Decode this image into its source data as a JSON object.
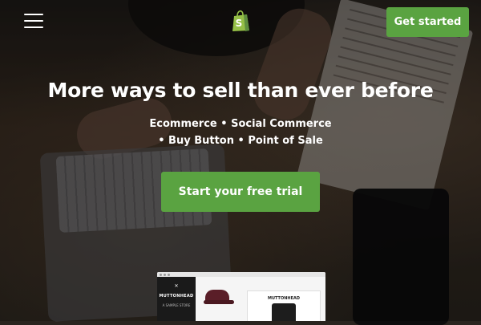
{
  "header": {
    "menu_icon": "hamburger-menu-icon",
    "logo_icon": "shopify-bag-icon",
    "cta_label": "Get started"
  },
  "hero": {
    "headline": "More ways to sell than ever before",
    "subline_1": "Ecommerce • Social Commerce",
    "subline_2": "• Buy Button • Point of Sale",
    "cta_label": "Start your free trial"
  },
  "preview": {
    "brand": "MUTTONHEAD",
    "store_tagline": "A SAMPLE STORE"
  },
  "colors": {
    "accent": "#5aa341",
    "text": "#ffffff"
  }
}
